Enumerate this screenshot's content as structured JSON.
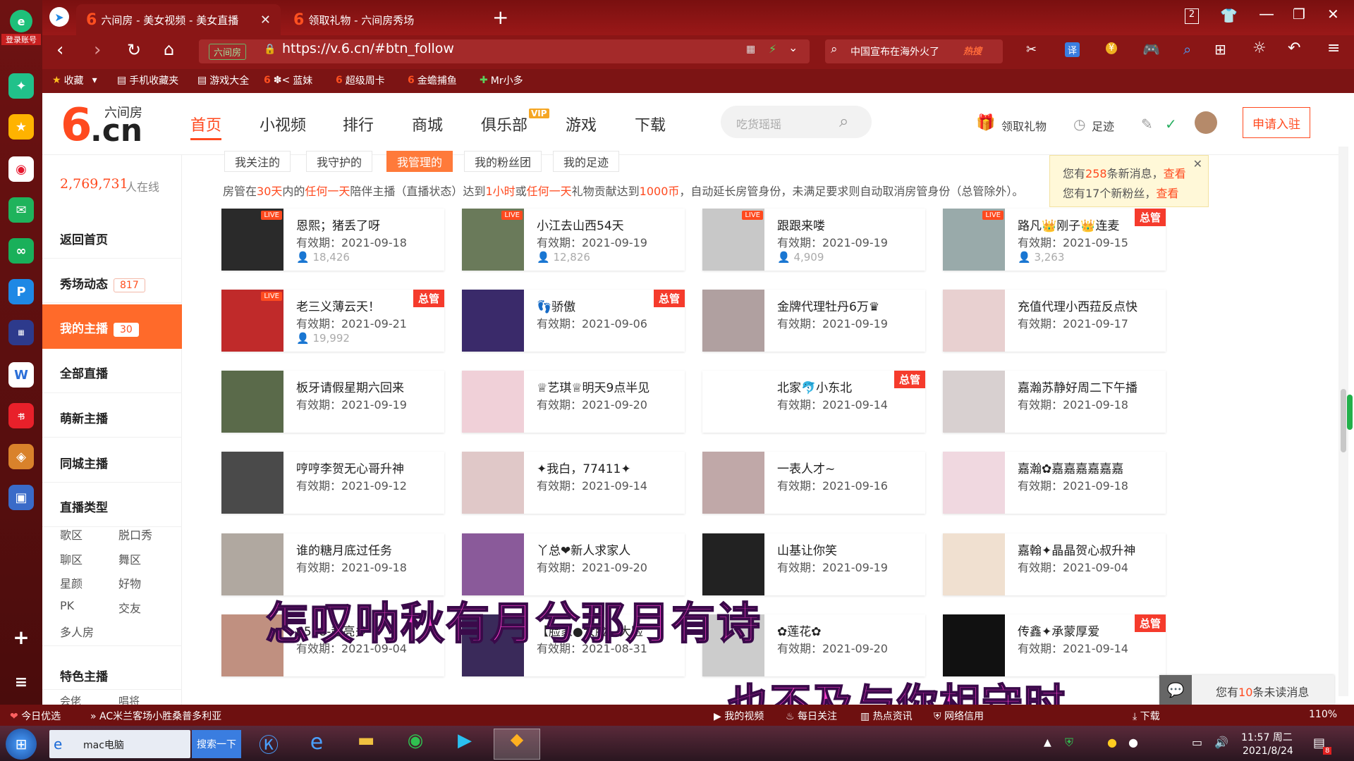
{
  "browser": {
    "login_label": "登录账号",
    "tabs": [
      {
        "title": "六间房 - 美女视频 - 美女直播"
      },
      {
        "title": "领取礼物 - 六间房秀场"
      }
    ],
    "tab_count": "2",
    "url": "https://v.6.cn/#btn_follow",
    "url_site_tag": "六间房",
    "search_text": "中国宣布在海外火了",
    "search_hot": "热搜",
    "bookmarks": [
      "收藏",
      "手机收藏夹",
      "游戏大全",
      "蓝妹",
      "超级周卡",
      "金蟾捕鱼",
      "Mr小多"
    ]
  },
  "site": {
    "logo_text": "六间房",
    "logo_cn": ".cn",
    "nav": [
      "首页",
      "小视频",
      "排行",
      "商城",
      "俱乐部",
      "游戏",
      "下载"
    ],
    "vip_badge": "VIP",
    "search_placeholder": "吃货瑶瑶",
    "gift_label": "领取礼物",
    "footprint_label": "足迹",
    "apply_button": "申请入驻"
  },
  "leftnav": {
    "online_count": "2,769,731",
    "online_label": "人在线",
    "items": [
      {
        "label": "返回首页"
      },
      {
        "label": "秀场动态",
        "badge": "817"
      },
      {
        "label": "我的主播",
        "badge": "30"
      },
      {
        "label": "全部直播"
      },
      {
        "label": "萌新主播"
      },
      {
        "label": "同城主播"
      }
    ],
    "category_title": "直播类型",
    "categories": [
      "歌区",
      "脱口秀",
      "聊区",
      "舞区",
      "星颜",
      "好物",
      "PK",
      "交友",
      "多人房"
    ],
    "feature_title": "特色主播",
    "feature_items": [
      "会佬",
      "唱将"
    ]
  },
  "subtabs": [
    "我关注的",
    "我守护的",
    "我管理的",
    "我的粉丝团",
    "我的足迹"
  ],
  "notice": {
    "t1": "房管在",
    "d1": "30天",
    "t2": "内的",
    "d2": "任何一天",
    "t3": "陪伴主播（直播状态）达到",
    "d3": "1小时",
    "t4": "或",
    "d4": "任何一天",
    "t5": "礼物贡献达到",
    "d5": "1000币",
    "t6": "，自动延长房管身份，未满足要求则自动取消房管身份（总管除外）。"
  },
  "popup": {
    "line1_a": "您有",
    "line1_n": "258",
    "line1_b": "条新消息，",
    "line1_link": "查看",
    "line2_a": "您有17个新粉丝，",
    "line2_link": "查看"
  },
  "cards": [
    {
      "name": "恩熙；猪丢了呀",
      "valid": "有效期：2021-09-18",
      "viewers": "18,426",
      "live": "LIVE"
    },
    {
      "name": "小江去山西54天",
      "valid": "有效期：2021-09-19",
      "viewers": "12,826",
      "live": "LIVE"
    },
    {
      "name": "跟跟来喽",
      "valid": "有效期：2021-09-19",
      "viewers": "4,909",
      "live": "LIVE"
    },
    {
      "name": "路凡👑刚子👑连麦",
      "valid": "有效期：2021-09-15",
      "viewers": "3,263",
      "live": "LIVE",
      "zg": "总管"
    },
    {
      "name": "老三义薄云天！",
      "valid": "有效期：2021-09-21",
      "viewers": "19,992",
      "live": "LIVE",
      "zg": "总管"
    },
    {
      "name": "👣骄傲",
      "valid": "有效期：2021-09-06",
      "zg": "总管"
    },
    {
      "name": "金牌代理牡丹6万♛",
      "valid": "有效期：2021-09-19"
    },
    {
      "name": "充值代理小西菈反点快",
      "valid": "有效期：2021-09-17"
    },
    {
      "name": "板牙请假星期六回来",
      "valid": "有效期：2021-09-19"
    },
    {
      "name": "♕艺琪♕明天9点半见",
      "valid": "有效期：2021-09-20"
    },
    {
      "name": "北家🐬小东北",
      "valid": "有效期：2021-09-14",
      "zg": "总管"
    },
    {
      "name": "嘉瀚苏静好周二下午播",
      "valid": "有效期：2021-09-18"
    },
    {
      "name": "哼哼李贺无心哥升神",
      "valid": "有效期：2021-09-12"
    },
    {
      "name": "✦我白，77411✦",
      "valid": "有效期：2021-09-14"
    },
    {
      "name": "一表人才~",
      "valid": "有效期：2021-09-16"
    },
    {
      "name": "嘉瀚✿嘉嘉嘉嘉嘉嘉",
      "valid": "有效期：2021-09-18"
    },
    {
      "name": "谁的糖月底过任务",
      "valid": "有效期：2021-09-18"
    },
    {
      "name": "丫总❤新人求家人",
      "valid": "有效期：2021-09-20"
    },
    {
      "name": "山基让你笑",
      "valid": "有效期：2021-09-19"
    },
    {
      "name": "嘉翰✦晶晶贺心叔升神",
      "valid": "有效期：2021-09-04"
    },
    {
      "name": "6598-赵亮多",
      "valid": "有效期：2021-09-04"
    },
    {
      "name": "【脸家●大脸】大脸",
      "valid": "有效期：2021-08-31"
    },
    {
      "name": "✿莲花✿",
      "valid": "有效期：2021-09-20"
    },
    {
      "name": "传鑫✦承蒙厚爱",
      "valid": "有效期：2021-09-14",
      "zg": "总管"
    }
  ],
  "overlay": {
    "line1": "怎叹呐秋有月兮那月有诗",
    "line2": "也不及与你相守时"
  },
  "unread": {
    "a": "您有",
    "n": "10",
    "b": "条未读消息"
  },
  "statusbar": {
    "today": "今日优选",
    "headline": "AC米兰客场小胜桑普多利亚",
    "items": [
      "我的视频",
      "每日关注",
      "热点资讯",
      "网络信用"
    ],
    "download": "下载",
    "zoom": "110%"
  },
  "taskbar": {
    "ie_title": "mac电脑",
    "search_btn": "搜索一下",
    "time": "11:57 周二",
    "date": "2021/8/24",
    "notif": "8"
  },
  "colors": {
    "accent": "#ff4a1f",
    "browser": "#8a1616"
  }
}
